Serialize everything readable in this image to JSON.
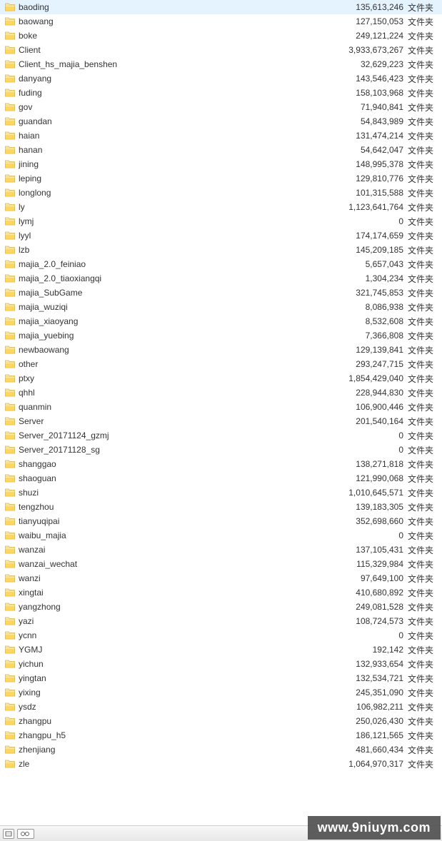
{
  "type_label": "文件夹",
  "watermark": "www.9niuym.com",
  "folders": [
    {
      "name": "baoding",
      "size": "135,613,246"
    },
    {
      "name": "baowang",
      "size": "127,150,053"
    },
    {
      "name": "boke",
      "size": "249,121,224"
    },
    {
      "name": "Client",
      "size": "3,933,673,267"
    },
    {
      "name": "Client_hs_majia_benshen",
      "size": "32,629,223"
    },
    {
      "name": "danyang",
      "size": "143,546,423"
    },
    {
      "name": "fuding",
      "size": "158,103,968"
    },
    {
      "name": "gov",
      "size": "71,940,841"
    },
    {
      "name": "guandan",
      "size": "54,843,989"
    },
    {
      "name": "haian",
      "size": "131,474,214"
    },
    {
      "name": "hanan",
      "size": "54,642,047"
    },
    {
      "name": "jining",
      "size": "148,995,378"
    },
    {
      "name": "leping",
      "size": "129,810,776"
    },
    {
      "name": "longlong",
      "size": "101,315,588"
    },
    {
      "name": "ly",
      "size": "1,123,641,764"
    },
    {
      "name": "lymj",
      "size": "0"
    },
    {
      "name": "lyyl",
      "size": "174,174,659"
    },
    {
      "name": "lzb",
      "size": "145,209,185"
    },
    {
      "name": "majia_2.0_feiniao",
      "size": "5,657,043"
    },
    {
      "name": "majia_2.0_tiaoxiangqi",
      "size": "1,304,234"
    },
    {
      "name": "majia_SubGame",
      "size": "321,745,853"
    },
    {
      "name": "majia_wuziqi",
      "size": "8,086,938"
    },
    {
      "name": "majia_xiaoyang",
      "size": "8,532,608"
    },
    {
      "name": "majia_yuebing",
      "size": "7,366,808"
    },
    {
      "name": "newbaowang",
      "size": "129,139,841"
    },
    {
      "name": "other",
      "size": "293,247,715"
    },
    {
      "name": "ptxy",
      "size": "1,854,429,040"
    },
    {
      "name": "qhhl",
      "size": "228,944,830"
    },
    {
      "name": "quanmin",
      "size": "106,900,446"
    },
    {
      "name": "Server",
      "size": "201,540,164"
    },
    {
      "name": "Server_20171124_gzmj",
      "size": "0"
    },
    {
      "name": "Server_20171128_sg",
      "size": "0"
    },
    {
      "name": "shanggao",
      "size": "138,271,818"
    },
    {
      "name": "shaoguan",
      "size": "121,990,068"
    },
    {
      "name": "shuzi",
      "size": "1,010,645,571"
    },
    {
      "name": "tengzhou",
      "size": "139,183,305"
    },
    {
      "name": "tianyuqipai",
      "size": "352,698,660"
    },
    {
      "name": "waibu_majia",
      "size": "0"
    },
    {
      "name": "wanzai",
      "size": "137,105,431"
    },
    {
      "name": "wanzai_wechat",
      "size": "115,329,984"
    },
    {
      "name": "wanzi",
      "size": "97,649,100"
    },
    {
      "name": "xingtai",
      "size": "410,680,892"
    },
    {
      "name": "yangzhong",
      "size": "249,081,528"
    },
    {
      "name": "yazi",
      "size": "108,724,573"
    },
    {
      "name": "ycnn",
      "size": "0"
    },
    {
      "name": "YGMJ",
      "size": "192,142"
    },
    {
      "name": "yichun",
      "size": "132,933,654"
    },
    {
      "name": "yingtan",
      "size": "132,534,721"
    },
    {
      "name": "yixing",
      "size": "245,351,090"
    },
    {
      "name": "ysdz",
      "size": "106,982,211"
    },
    {
      "name": "zhangpu",
      "size": "250,026,430"
    },
    {
      "name": "zhangpu_h5",
      "size": "186,121,565"
    },
    {
      "name": "zhenjiang",
      "size": "481,660,434"
    },
    {
      "name": "zle",
      "size": "1,064,970,317"
    }
  ]
}
